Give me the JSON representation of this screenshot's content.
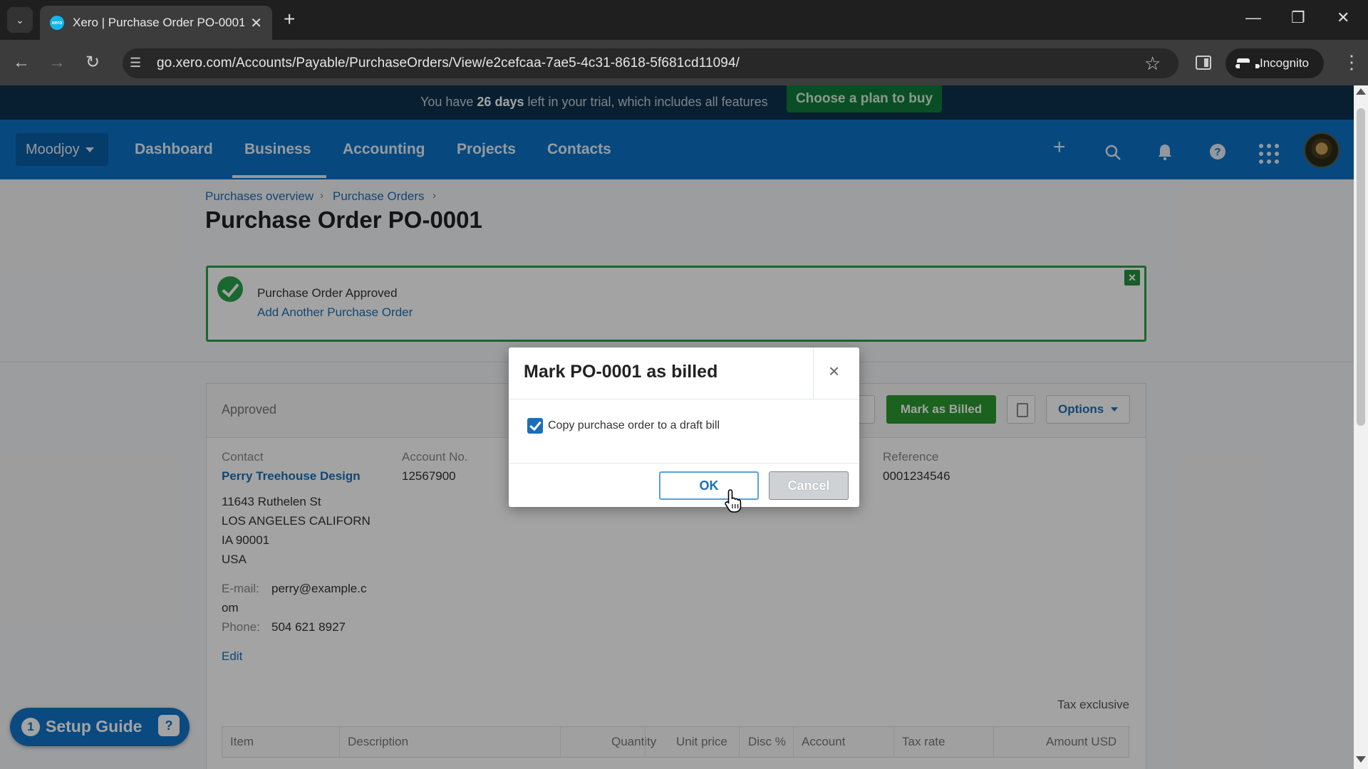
{
  "browser": {
    "tab_title": "Xero | Purchase Order PO-0001",
    "favicon_label": "xero",
    "url": "go.xero.com/Accounts/Payable/PurchaseOrders/View/e2cefcaa-7ae5-4c31-8618-5f681cd11094/",
    "profile_label": "Incognito",
    "icons": {
      "tab_search": "chevron-down-icon",
      "close_tab": "close-icon",
      "new_tab": "plus-icon",
      "back": "arrow-left-icon",
      "forward": "arrow-right-icon",
      "reload": "reload-icon",
      "site_info": "tune-icon",
      "bookmark": "star-icon",
      "menu": "kebab-icon"
    }
  },
  "trial_banner": {
    "text_before": "You have ",
    "days": "26 days",
    "text_after": " left in your trial, which includes all features",
    "cta": "Choose a plan to buy"
  },
  "nav": {
    "org": "Moodjoy",
    "links": [
      "Dashboard",
      "Business",
      "Accounting",
      "Projects",
      "Contacts"
    ],
    "active": "Business",
    "icons": [
      "plus-icon",
      "search-icon",
      "bell-icon",
      "help-icon",
      "apps-grid-icon"
    ]
  },
  "breadcrumb": [
    "Purchases overview",
    "Purchase Orders"
  ],
  "page_title": "Purchase Order PO-0001",
  "alert": {
    "title": "Purchase Order Approved",
    "link": "Add Another Purchase Order"
  },
  "order": {
    "status": "Approved",
    "actions": {
      "mark_billed": "Mark as Billed",
      "options": "Options"
    },
    "contact_label": "Contact",
    "contact_name": "Perry Treehouse Design",
    "address": [
      "11643 Ruthelen St",
      "LOS ANGELES CALIFORN",
      "IA 90001",
      "USA"
    ],
    "email_label": "E-mail:",
    "email_lines": [
      "perry@example.c",
      "om"
    ],
    "phone_label": "Phone:",
    "phone": "504 621 8927",
    "edit": "Edit",
    "account_no_label": "Account No.",
    "account_no": "12567900",
    "reference_label": "Reference",
    "reference": "0001234546",
    "tax_mode": "Tax exclusive",
    "table_headers": [
      "Item",
      "Description",
      "Quantity",
      "Unit price",
      "Disc %",
      "Account",
      "Tax rate",
      "Amount USD"
    ]
  },
  "setup_guide": {
    "count": "1",
    "label": "Setup Guide"
  },
  "modal": {
    "title": "Mark PO-0001 as billed",
    "checkbox_label": "Copy purchase order to a draft bill",
    "checkbox_checked": true,
    "ok": "OK",
    "cancel": "Cancel"
  },
  "colors": {
    "xero_blue": "#0b72c6",
    "success_green": "#2aa14a",
    "link_blue": "#1b6fb8"
  }
}
